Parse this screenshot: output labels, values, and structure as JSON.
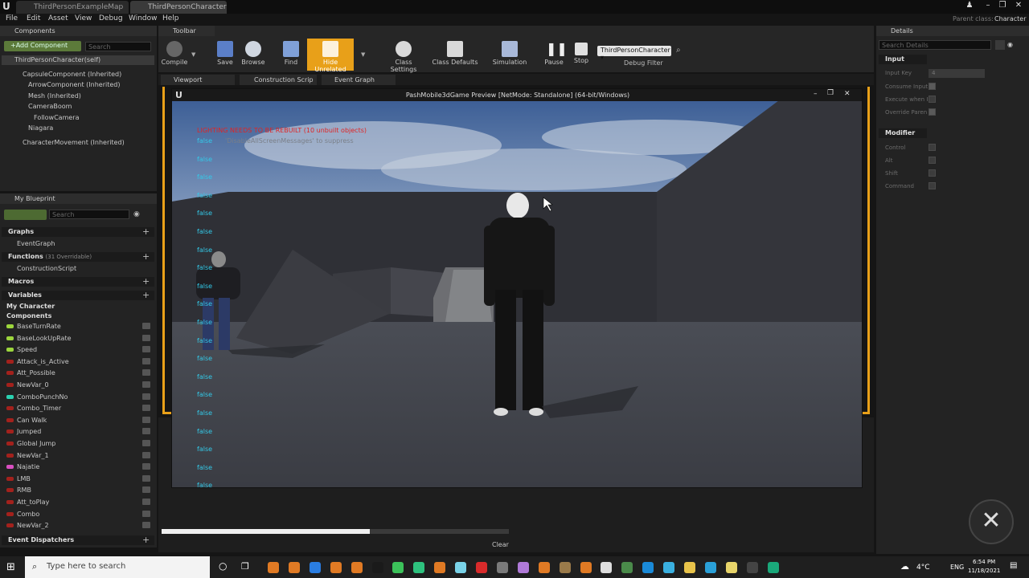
{
  "window": {
    "tabs": [
      "ThirdPersonExampleMap",
      "ThirdPersonCharacter"
    ],
    "parent_class_label": "Parent class:",
    "parent_class_value": "Character"
  },
  "menu": [
    "File",
    "Edit",
    "Asset",
    "View",
    "Debug",
    "Window",
    "Help"
  ],
  "components": {
    "title": "Components",
    "add_label": "+Add Component",
    "search_placeholder": "Search",
    "items": [
      "ThirdPersonCharacter(self)",
      "CapsuleComponent (Inherited)",
      "ArrowComponent (Inherited)",
      "Mesh (Inherited)",
      "CameraBoom",
      "FollowCamera",
      "Niagara",
      "CharacterMovement (Inherited)"
    ]
  },
  "toolbar": {
    "title": "Toolbar",
    "buttons": [
      "Compile",
      "Save",
      "Browse",
      "Find",
      "Hide Unrelated",
      "Class Settings",
      "Class Defaults",
      "Simulation",
      "Pause",
      "Stop"
    ],
    "debug_object": "ThirdPersonCharacter",
    "debug_filter": "Debug Filter"
  },
  "editor_tabs": [
    "Viewport",
    "Construction Scrip",
    "Event Graph"
  ],
  "my_blueprint": {
    "title": "My Blueprint",
    "search_placeholder": "Search",
    "graphs_label": "Graphs",
    "event_graph": "EventGraph",
    "functions_label": "Functions",
    "functions_count": "(31 Overridable)",
    "construction_script": "ConstructionScript",
    "macros_label": "Macros",
    "variables_label": "Variables",
    "my_character_label": "My Character",
    "components_label": "Components",
    "variables": [
      {
        "name": "BaseTurnRate",
        "color": "#9cd63d"
      },
      {
        "name": "BaseLookUpRate",
        "color": "#9cd63d"
      },
      {
        "name": "Speed",
        "color": "#9cd63d"
      },
      {
        "name": "Attack_is_Active",
        "color": "#a3211c"
      },
      {
        "name": "Att_Possible",
        "color": "#a3211c"
      },
      {
        "name": "NewVar_0",
        "color": "#a3211c"
      },
      {
        "name": "ComboPunchNo",
        "color": "#2bd1b0"
      },
      {
        "name": "Combo_Timer",
        "color": "#a3211c"
      },
      {
        "name": "Can Walk",
        "color": "#a3211c"
      },
      {
        "name": "Jumped",
        "color": "#a3211c"
      },
      {
        "name": "Global Jump",
        "color": "#a3211c"
      },
      {
        "name": "NewVar_1",
        "color": "#a3211c"
      },
      {
        "name": "Najatie",
        "color": "#d94fc0"
      },
      {
        "name": "LMB",
        "color": "#a3211c"
      },
      {
        "name": "RMB",
        "color": "#a3211c"
      },
      {
        "name": "Att_toPlay",
        "color": "#a3211c"
      },
      {
        "name": "Combo",
        "color": "#a3211c"
      },
      {
        "name": "NewVar_2",
        "color": "#a3211c"
      }
    ],
    "event_dispatchers_label": "Event Dispatchers"
  },
  "preview": {
    "title": "PashMobile3dGame Preview [NetMode: Standalone] (64-bit/Windows)",
    "lighting_warning": "LIGHTING NEEDS TO BE REBUILT (10 unbuilt objects)",
    "disable_msg": "'DisableAllScreenMessages' to suppress",
    "false_text": "false",
    "false_count": 20
  },
  "output": {
    "clear_label": "Clear",
    "progress": 0.6
  },
  "details": {
    "title": "Details",
    "search_placeholder": "Search Details",
    "input_section": "Input",
    "input_key_label": "Input Key",
    "input_key_value": "4",
    "consume_label": "Consume Input",
    "execute_label": "Execute when I",
    "override_label": "Override Paren",
    "modifier_section": "Modifier",
    "control_label": "Control",
    "alt_label": "Alt",
    "shift_label": "Shift",
    "command_label": "Command"
  },
  "taskbar": {
    "search_placeholder": "Type here to search",
    "weather": "4°C",
    "language": "ENG",
    "time": "6:54 PM",
    "date": "11/18/2021"
  },
  "colors": {
    "accent_orange": "#e8a019",
    "false_blue": "#33c9e8",
    "warning_red": "#e02424"
  }
}
